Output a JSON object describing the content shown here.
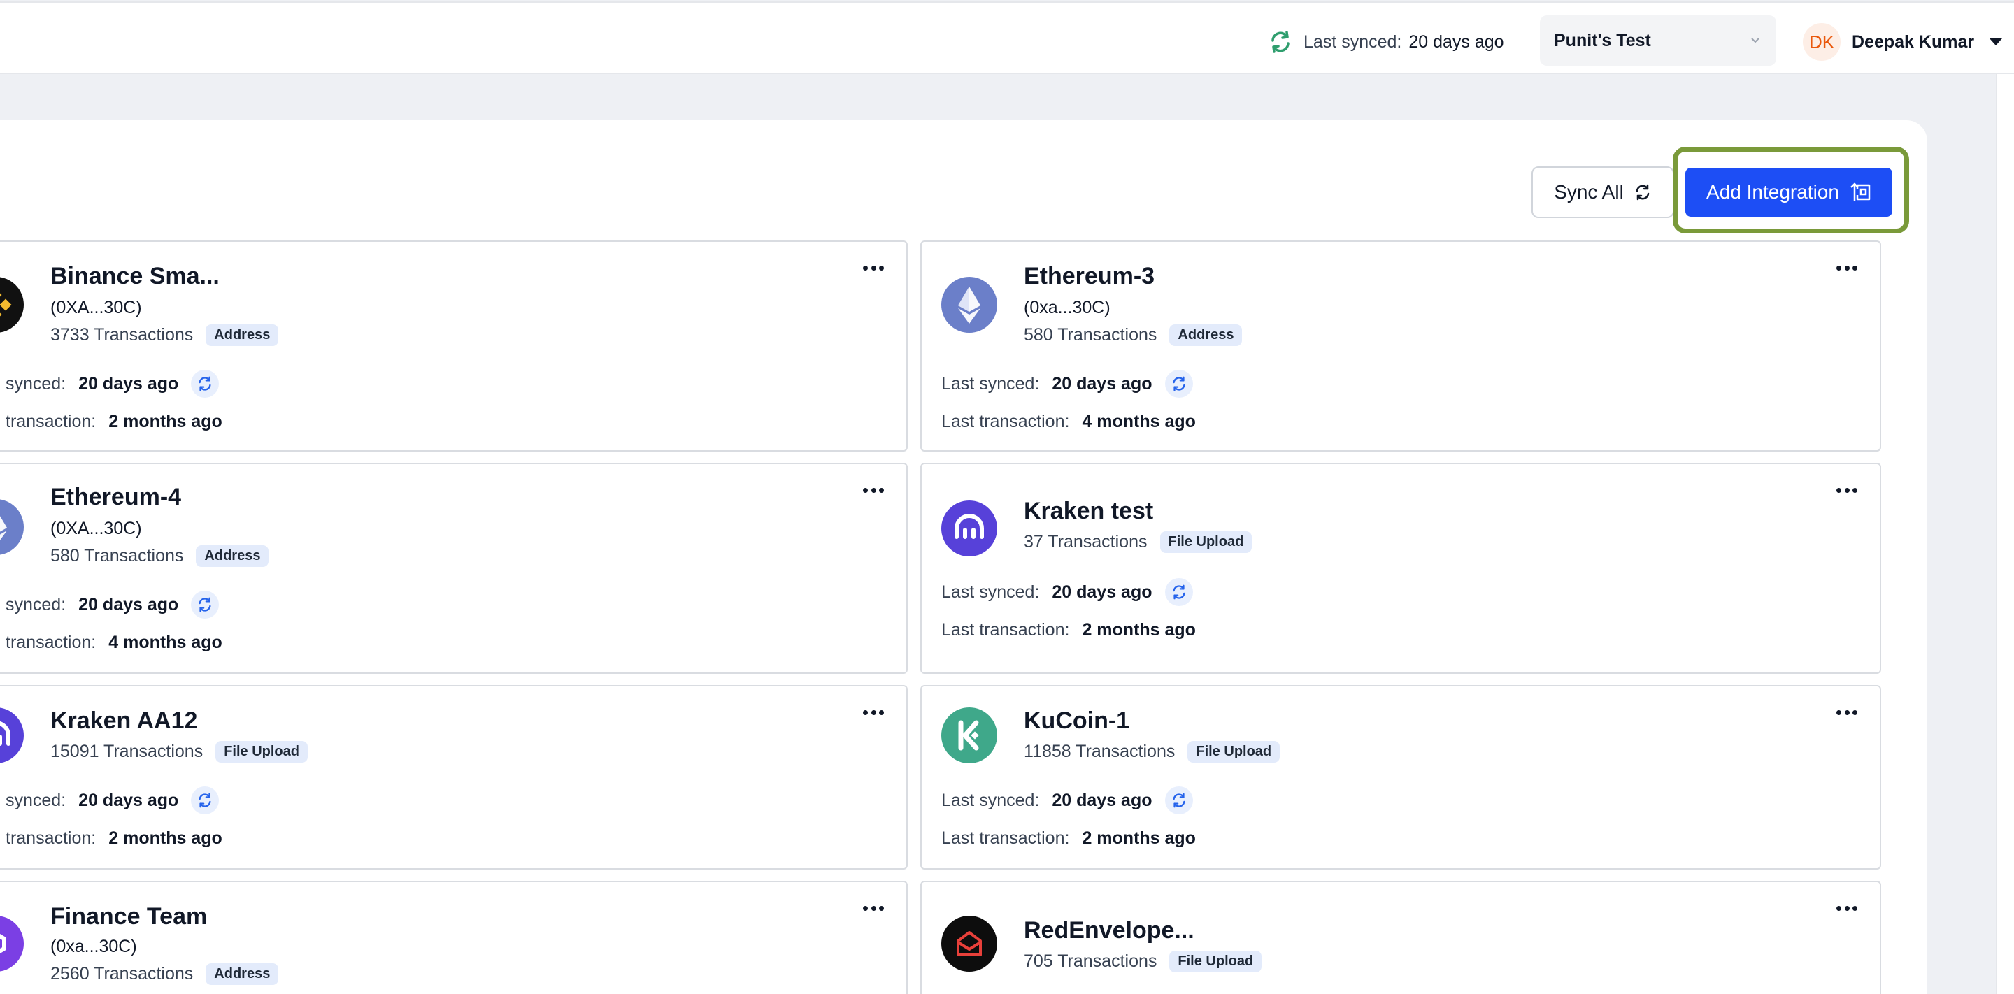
{
  "header": {
    "sync_label": "Last synced:",
    "sync_value": "20 days ago",
    "workspace": "Punit's Test",
    "user_initials": "DK",
    "user_name": "Deepak Kumar"
  },
  "toolbar": {
    "sync_all_label": "Sync All",
    "add_integration_label": "Add Integration"
  },
  "labels": {
    "last_synced": "Last synced:",
    "last_transaction": "Last transaction:",
    "last_synced_clipped": "synced:",
    "last_transaction_clipped": "transaction:"
  },
  "integrations": [
    {
      "name": "Binance Sma...",
      "address": "(0XA...30C)",
      "transactions": "3733 Transactions",
      "type": "Address",
      "last_synced": "20 days ago",
      "last_transaction": "2 months ago",
      "icon": "binance-icon"
    },
    {
      "name": "Ethereum-3",
      "address": "(0xa...30C)",
      "transactions": "580 Transactions",
      "type": "Address",
      "last_synced": "20 days ago",
      "last_transaction": "4 months ago",
      "icon": "ethereum-icon"
    },
    {
      "name": "Ethereum-4",
      "address": "(0XA...30C)",
      "transactions": "580 Transactions",
      "type": "Address",
      "last_synced": "20 days ago",
      "last_transaction": "4 months ago",
      "icon": "ethereum-icon"
    },
    {
      "name": "Kraken test",
      "transactions": "37 Transactions",
      "type": "File Upload",
      "last_synced": "20 days ago",
      "last_transaction": "2 months ago",
      "icon": "kraken-icon"
    },
    {
      "name": "Kraken AA12",
      "transactions": "15091 Transactions",
      "type": "File Upload",
      "last_synced": "20 days ago",
      "last_transaction": "2 months ago",
      "icon": "kraken-icon"
    },
    {
      "name": "KuCoin-1",
      "transactions": "11858 Transactions",
      "type": "File Upload",
      "last_synced": "20 days ago",
      "last_transaction": "2 months ago",
      "icon": "kucoin-icon"
    },
    {
      "name": "Finance Team",
      "address": "(0xa...30C)",
      "transactions": "2560 Transactions",
      "type": "Address",
      "icon": "polygon-icon"
    },
    {
      "name": "RedEnvelope...",
      "transactions": "705 Transactions",
      "type": "File Upload",
      "icon": "redenvelope-icon"
    }
  ],
  "colors": {
    "primary": "#1d4ef5",
    "highlight": "#7a9a3a",
    "badge_bg": "#e3ebfb",
    "sync_green": "#2f9e6e"
  }
}
